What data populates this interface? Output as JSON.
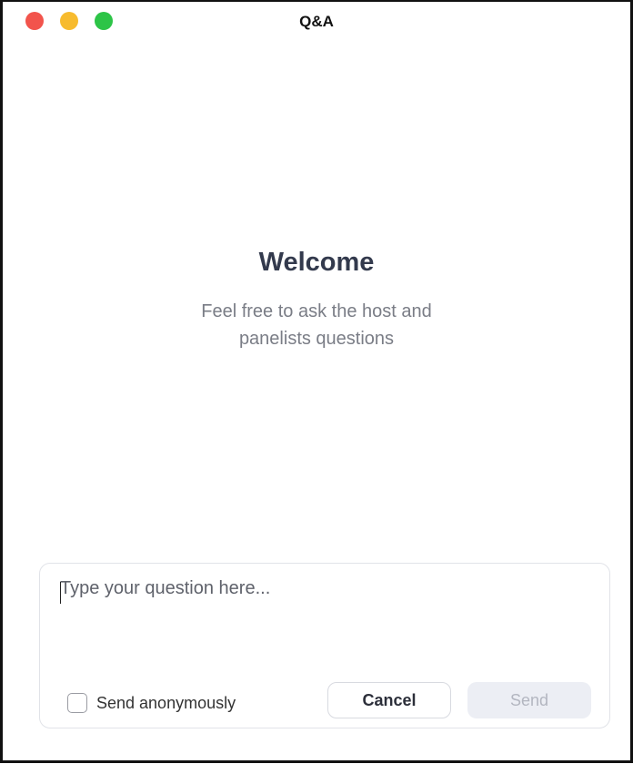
{
  "window": {
    "title": "Q&A"
  },
  "welcome": {
    "heading": "Welcome",
    "subtitle": "Feel free to ask the host and panelists questions"
  },
  "composer": {
    "placeholder": "Type your question here...",
    "anonymous_label": "Send anonymously",
    "anonymous_checked": false,
    "cancel_label": "Cancel",
    "send_label": "Send",
    "send_enabled": false
  },
  "colors": {
    "close": "#f2544c",
    "minimize": "#f7bb2e",
    "zoom": "#2dc447",
    "heading": "#333a4d",
    "subtitle": "#7a7d86",
    "send_disabled_bg": "#eceef4"
  }
}
